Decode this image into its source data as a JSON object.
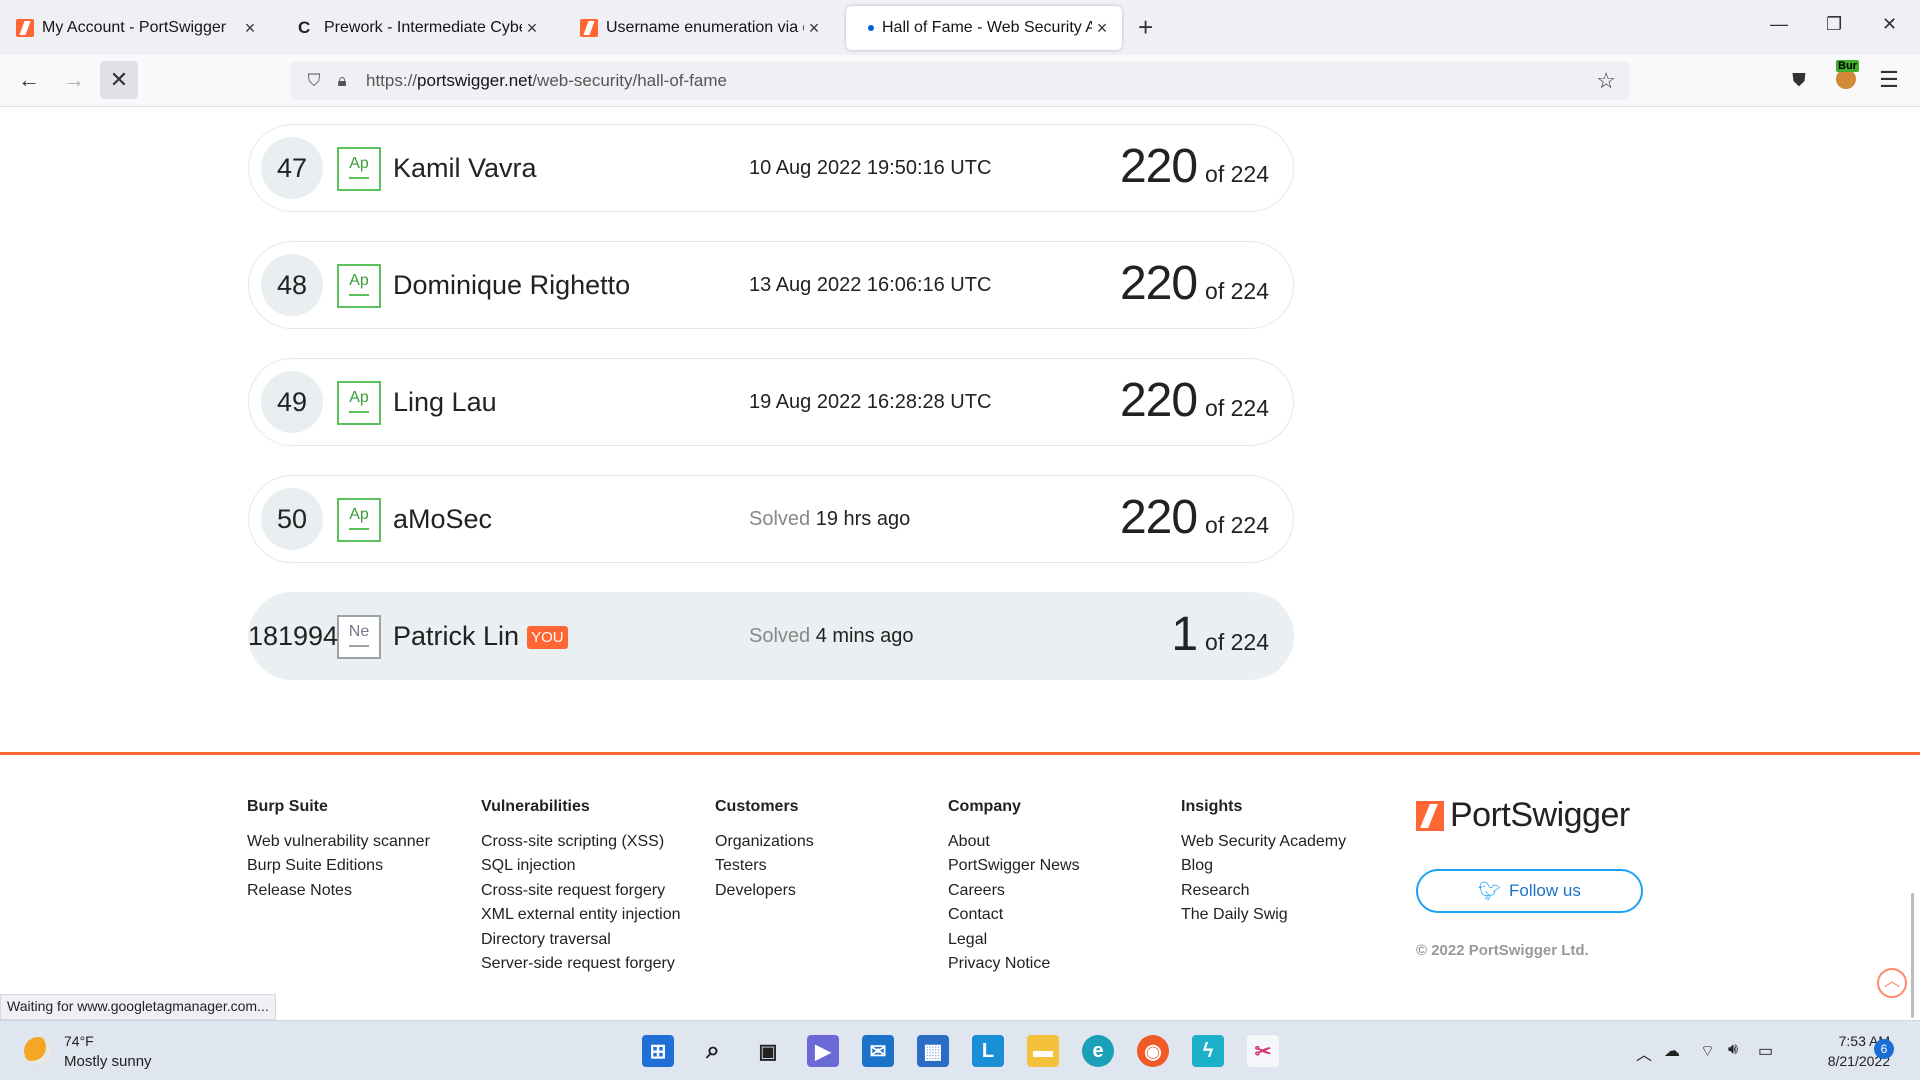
{
  "browser": {
    "tabs": [
      {
        "title": "My Account - PortSwigger",
        "favicon": "portswigger-icon"
      },
      {
        "title": "Prework - Intermediate Cyberse",
        "favicon": "c-icon"
      },
      {
        "title": "Username enumeration via diffe",
        "favicon": "portswigger-icon"
      },
      {
        "title": "Hall of Fame - Web Security Ac",
        "favicon": "loading-dot-icon",
        "active": true
      }
    ],
    "url_prefix": "https://",
    "url_host": "portswigger.net",
    "url_path": "/web-security/hall-of-fame",
    "extension_badge": "Bur"
  },
  "leaderboard": [
    {
      "rank": "47",
      "badge": "Ap",
      "name": "Kamil Vavra",
      "when": "10 Aug 2022 19:50:16 UTC",
      "score": "220",
      "total": "of 224"
    },
    {
      "rank": "48",
      "badge": "Ap",
      "name": "Dominique Righetto",
      "when": "13 Aug 2022 16:06:16 UTC",
      "score": "220",
      "total": "of 224"
    },
    {
      "rank": "49",
      "badge": "Ap",
      "name": "Ling Lau",
      "when": "19 Aug 2022 16:28:28 UTC",
      "score": "220",
      "total": "of 224"
    },
    {
      "rank": "50",
      "badge": "Ap",
      "name": "aMoSec",
      "solved_label": "Solved",
      "when": "19 hrs ago",
      "score": "220",
      "total": "of 224"
    },
    {
      "rank": "181994",
      "badge": "Ne",
      "name": "Patrick Lin",
      "you": "YOU",
      "solved_label": "Solved",
      "when": "4 mins ago",
      "score": "1",
      "total": "of 224"
    }
  ],
  "footer": {
    "columns": [
      {
        "heading": "Burp Suite",
        "links": [
          "Web vulnerability scanner",
          "Burp Suite Editions",
          "Release Notes"
        ]
      },
      {
        "heading": "Vulnerabilities",
        "links": [
          "Cross-site scripting (XSS)",
          "SQL injection",
          "Cross-site request forgery",
          "XML external entity injection",
          "Directory traversal",
          "Server-side request forgery"
        ]
      },
      {
        "heading": "Customers",
        "links": [
          "Organizations",
          "Testers",
          "Developers"
        ]
      },
      {
        "heading": "Company",
        "links": [
          "About",
          "PortSwigger News",
          "Careers",
          "Contact",
          "Legal",
          "Privacy Notice"
        ]
      },
      {
        "heading": "Insights",
        "links": [
          "Web Security Academy",
          "Blog",
          "Research",
          "The Daily Swig"
        ]
      }
    ],
    "logo_text": "PortSwigger",
    "follow_label": "Follow us",
    "copyright": "© 2022 PortSwigger Ltd."
  },
  "status_text": "Waiting for www.googletagmanager.com...",
  "taskbar": {
    "weather_temp": "74°F",
    "weather_desc": "Mostly sunny",
    "time": "7:53 AM",
    "date": "8/21/2022",
    "notifications": "6"
  },
  "colors": {
    "brand": "#ff6633",
    "twitter": "#1da1f2"
  }
}
